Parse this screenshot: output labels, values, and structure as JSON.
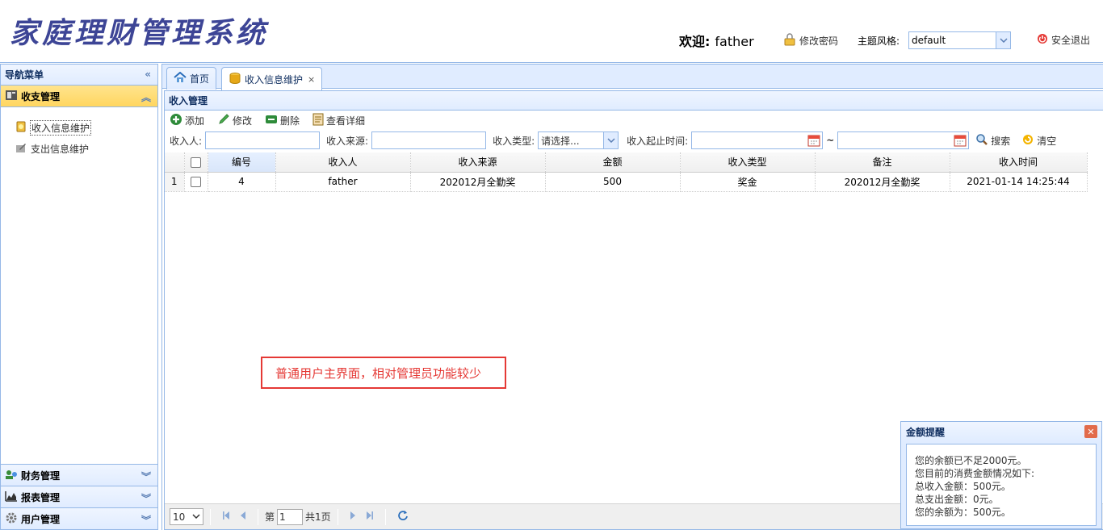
{
  "header": {
    "title": "家庭理财管理系统",
    "welcome_label": "欢迎:",
    "username": "father",
    "change_password": "修改密码",
    "theme_label": "主题风格:",
    "theme_value": "default",
    "logout": "安全退出"
  },
  "nav": {
    "title": "导航菜单",
    "sections": [
      {
        "label": "收支管理",
        "icon": "ledger-icon",
        "expanded": true
      },
      {
        "label": "财务管理",
        "icon": "finance-icon",
        "expanded": false
      },
      {
        "label": "报表管理",
        "icon": "report-icon",
        "expanded": false
      },
      {
        "label": "用户管理",
        "icon": "gear-icon",
        "expanded": false
      }
    ],
    "items": [
      {
        "label": "收入信息维护",
        "selected": true
      },
      {
        "label": "支出信息维护",
        "selected": false
      }
    ]
  },
  "tabs": [
    {
      "label": "首页",
      "icon": "home-icon"
    },
    {
      "label": "收入信息维护",
      "icon": "coins-icon",
      "closable": true
    }
  ],
  "content": {
    "title": "收入管理",
    "toolbar": {
      "add": "添加",
      "edit": "修改",
      "delete": "删除",
      "detail": "查看详细"
    },
    "search": {
      "payee_label": "收入人:",
      "source_label": "收入来源:",
      "type_label": "收入类型:",
      "type_value": "请选择...",
      "time_label": "收入起止时间:",
      "range_sep": "~",
      "search_btn": "搜索",
      "clear_btn": "清空"
    },
    "grid": {
      "columns": [
        "编号",
        "收入人",
        "收入来源",
        "金额",
        "收入类型",
        "备注",
        "收入时间"
      ],
      "rows": [
        {
          "rownum": "1",
          "id": "4",
          "person": "father",
          "source": "202012月全勤奖",
          "amount": "500",
          "type": "奖金",
          "remark": "202012月全勤奖",
          "time": "2021-01-14 14:25:44"
        }
      ]
    },
    "pager": {
      "page_size": "10",
      "page_prefix": "第",
      "page_value": "1",
      "total_pages": "共1页"
    }
  },
  "annotation": "普通用户主界面，相对管理员功能较少",
  "popup": {
    "title": "金额提醒",
    "lines": [
      "您的余额已不足2000元。",
      "您目前的消费金额情况如下:",
      "总收入金额：500元。",
      "总支出金额：0元。",
      "您的余额为：500元。"
    ]
  },
  "colors": {
    "brand": "#3d4596",
    "border": "#95b8e7",
    "header_bg": "#e0ecff",
    "active_section": "#ffd660",
    "annotation": "#e53935"
  }
}
